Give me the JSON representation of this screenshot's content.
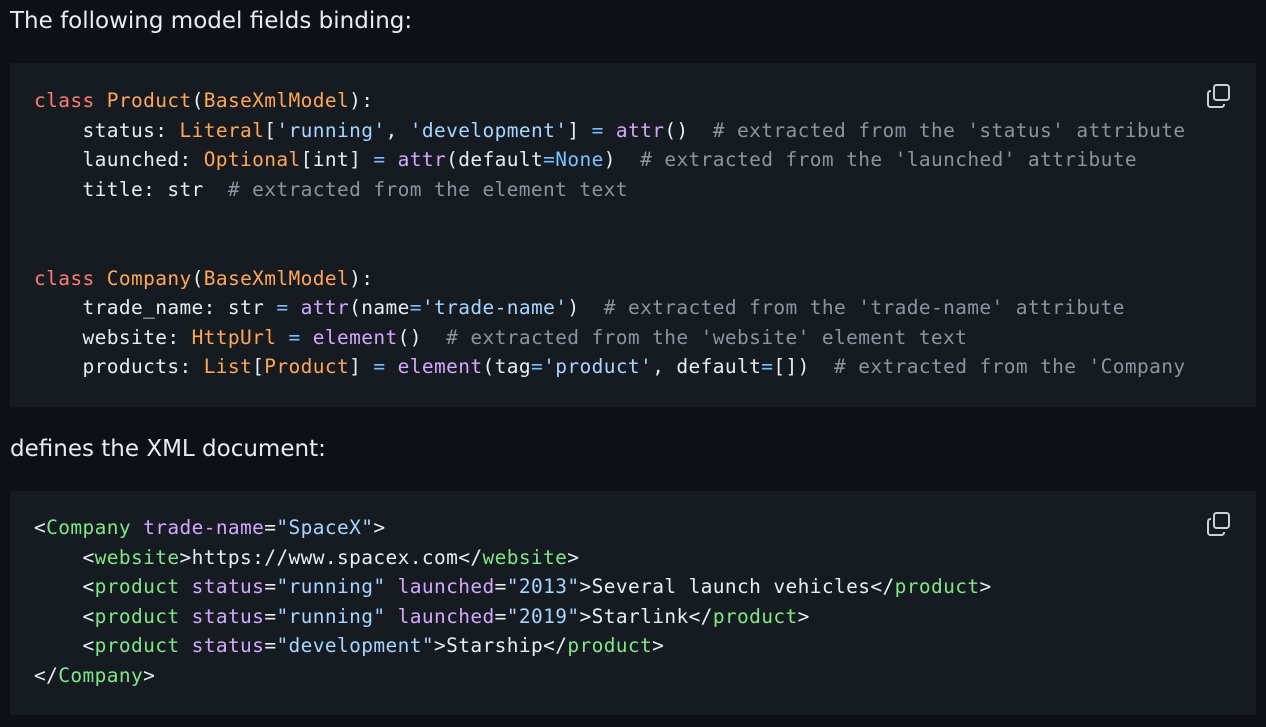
{
  "intro_text": "The following model fields binding:",
  "python_block": {
    "copy_icon": "copy-icon",
    "lines": [
      [
        [
          "kw",
          "class"
        ],
        [
          "t",
          " "
        ],
        [
          "cls",
          "Product"
        ],
        [
          "t",
          "("
        ],
        [
          "cls",
          "BaseXmlModel"
        ],
        [
          "t",
          "):"
        ]
      ],
      [
        [
          "t",
          "    status: "
        ],
        [
          "cls",
          "Literal"
        ],
        [
          "t",
          "["
        ],
        [
          "str",
          "'running'"
        ],
        [
          "t",
          ", "
        ],
        [
          "str",
          "'development'"
        ],
        [
          "t",
          "] "
        ],
        [
          "op",
          "="
        ],
        [
          "t",
          " "
        ],
        [
          "fn",
          "attr"
        ],
        [
          "t",
          "()  "
        ],
        [
          "cm",
          "# extracted from the 'status' attribute"
        ]
      ],
      [
        [
          "t",
          "    launched: "
        ],
        [
          "cls",
          "Optional"
        ],
        [
          "t",
          "[int] "
        ],
        [
          "op",
          "="
        ],
        [
          "t",
          " "
        ],
        [
          "fn",
          "attr"
        ],
        [
          "t",
          "(default"
        ],
        [
          "op",
          "="
        ],
        [
          "op",
          "None"
        ],
        [
          "t",
          ")  "
        ],
        [
          "cm",
          "# extracted from the 'launched' attribute"
        ]
      ],
      [
        [
          "t",
          "    title: str  "
        ],
        [
          "cm",
          "# extracted from the element text"
        ]
      ],
      [
        [
          "t",
          ""
        ]
      ],
      [
        [
          "t",
          ""
        ]
      ],
      [
        [
          "kw",
          "class"
        ],
        [
          "t",
          " "
        ],
        [
          "cls",
          "Company"
        ],
        [
          "t",
          "("
        ],
        [
          "cls",
          "BaseXmlModel"
        ],
        [
          "t",
          "):"
        ]
      ],
      [
        [
          "t",
          "    trade_name: str "
        ],
        [
          "op",
          "="
        ],
        [
          "t",
          " "
        ],
        [
          "fn",
          "attr"
        ],
        [
          "t",
          "(name"
        ],
        [
          "op",
          "="
        ],
        [
          "str",
          "'trade-name'"
        ],
        [
          "t",
          ")  "
        ],
        [
          "cm",
          "# extracted from the 'trade-name' attribute"
        ]
      ],
      [
        [
          "t",
          "    website: "
        ],
        [
          "cls",
          "HttpUrl"
        ],
        [
          "t",
          " "
        ],
        [
          "op",
          "="
        ],
        [
          "t",
          " "
        ],
        [
          "fn",
          "element"
        ],
        [
          "t",
          "()  "
        ],
        [
          "cm",
          "# extracted from the 'website' element text"
        ]
      ],
      [
        [
          "t",
          "    products: "
        ],
        [
          "cls",
          "List"
        ],
        [
          "t",
          "["
        ],
        [
          "cls",
          "Product"
        ],
        [
          "t",
          "] "
        ],
        [
          "op",
          "="
        ],
        [
          "t",
          " "
        ],
        [
          "fn",
          "element"
        ],
        [
          "t",
          "(tag"
        ],
        [
          "op",
          "="
        ],
        [
          "str",
          "'product'"
        ],
        [
          "t",
          ", default"
        ],
        [
          "op",
          "="
        ],
        [
          "t",
          "[])  "
        ],
        [
          "cm",
          "# extracted from the 'Company"
        ]
      ]
    ]
  },
  "middle_text": "defines the XML document:",
  "xml_block": {
    "copy_icon": "copy-icon",
    "lines": [
      [
        [
          "t",
          "<"
        ],
        [
          "tag",
          "Company"
        ],
        [
          "t",
          " "
        ],
        [
          "attr",
          "trade-name"
        ],
        [
          "t",
          "="
        ],
        [
          "str",
          "\"SpaceX\""
        ],
        [
          "t",
          ">"
        ]
      ],
      [
        [
          "t",
          "    <"
        ],
        [
          "tag",
          "website"
        ],
        [
          "t",
          ">https://www.spacex.com</"
        ],
        [
          "tag",
          "website"
        ],
        [
          "t",
          ">"
        ]
      ],
      [
        [
          "t",
          "    <"
        ],
        [
          "tag",
          "product"
        ],
        [
          "t",
          " "
        ],
        [
          "attr",
          "status"
        ],
        [
          "t",
          "="
        ],
        [
          "str",
          "\"running\""
        ],
        [
          "t",
          " "
        ],
        [
          "attr",
          "launched"
        ],
        [
          "t",
          "="
        ],
        [
          "str",
          "\"2013\""
        ],
        [
          "t",
          ">Several launch vehicles</"
        ],
        [
          "tag",
          "product"
        ],
        [
          "t",
          ">"
        ]
      ],
      [
        [
          "t",
          "    <"
        ],
        [
          "tag",
          "product"
        ],
        [
          "t",
          " "
        ],
        [
          "attr",
          "status"
        ],
        [
          "t",
          "="
        ],
        [
          "str",
          "\"running\""
        ],
        [
          "t",
          " "
        ],
        [
          "attr",
          "launched"
        ],
        [
          "t",
          "="
        ],
        [
          "str",
          "\"2019\""
        ],
        [
          "t",
          ">Starlink</"
        ],
        [
          "tag",
          "product"
        ],
        [
          "t",
          ">"
        ]
      ],
      [
        [
          "t",
          "    <"
        ],
        [
          "tag",
          "product"
        ],
        [
          "t",
          " "
        ],
        [
          "attr",
          "status"
        ],
        [
          "t",
          "="
        ],
        [
          "str",
          "\"development\""
        ],
        [
          "t",
          ">Starship</"
        ],
        [
          "tag",
          "product"
        ],
        [
          "t",
          ">"
        ]
      ],
      [
        [
          "t",
          "</"
        ],
        [
          "tag",
          "Company"
        ],
        [
          "t",
          ">"
        ]
      ]
    ]
  },
  "colors": {
    "page_bg": "#0d1117",
    "code_bg": "#161b22",
    "keyword": "#ff7b72",
    "class_name": "#ffa657",
    "function": "#d2a8ff",
    "string": "#a5d6ff",
    "operator": "#79c0ff",
    "comment": "#8b949e",
    "xml_tag": "#7ee787"
  }
}
